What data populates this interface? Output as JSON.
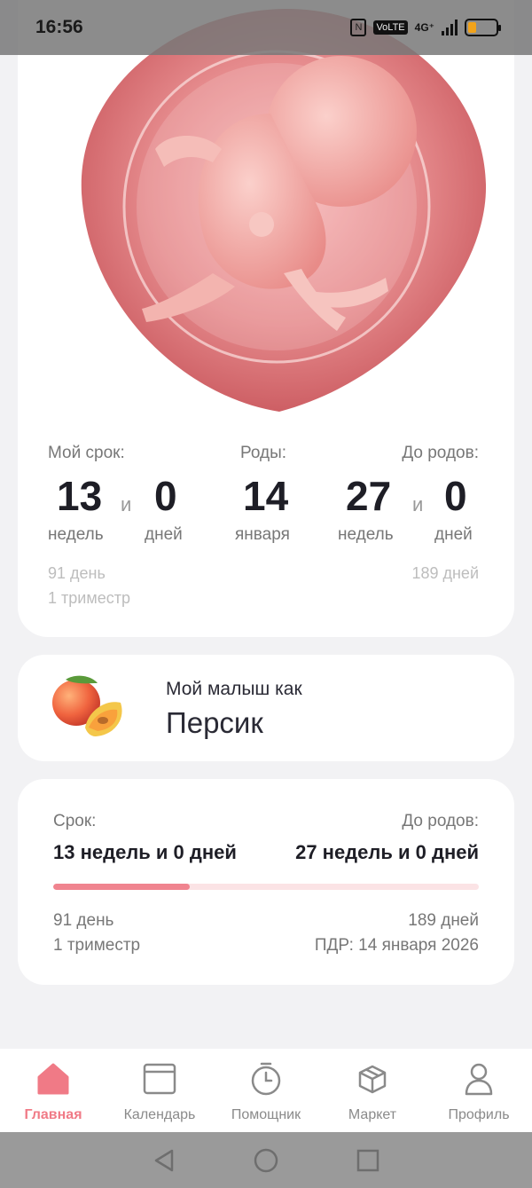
{
  "status_bar": {
    "time": "16:56",
    "nfc_label": "N",
    "volte_label": "VoLTE",
    "network_label": "4G⁺",
    "battery_level": 0.3
  },
  "term": {
    "headers": {
      "my_term": "Мой срок:",
      "birth": "Роды:",
      "until_birth": "До родов:"
    },
    "my_weeks": "13",
    "my_days": "0",
    "birth_day": "14",
    "until_weeks": "27",
    "until_days": "0",
    "and_word": "и",
    "units": {
      "weeks": "недель",
      "days": "дней",
      "month": "января"
    },
    "day_count": "91 день",
    "trimester": "1 триместр",
    "days_left": "189 дней"
  },
  "baby": {
    "label": "Мой малыш как",
    "fruit": "Персик",
    "icon": "peach-icon"
  },
  "progress": {
    "term_label": "Срок:",
    "until_label": "До родов:",
    "term_value": "13 недель и 0 дней",
    "until_value": "27 недель и 0 дней",
    "fraction": 0.32,
    "day_count": "91 день",
    "trimester": "1 триместр",
    "days_left": "189 дней",
    "due_date": "ПДР: 14 января 2026"
  },
  "tabs": [
    {
      "label": "Главная",
      "icon": "home-icon",
      "active": true
    },
    {
      "label": "Календарь",
      "icon": "calendar-icon",
      "active": false
    },
    {
      "label": "Помощник",
      "icon": "timer-icon",
      "active": false
    },
    {
      "label": "Маркет",
      "icon": "box-icon",
      "active": false
    },
    {
      "label": "Профиль",
      "icon": "profile-icon",
      "active": false
    }
  ],
  "colors": {
    "accent": "#f07a86",
    "progress_track": "#fbe3e5",
    "background": "#f2f2f4"
  }
}
